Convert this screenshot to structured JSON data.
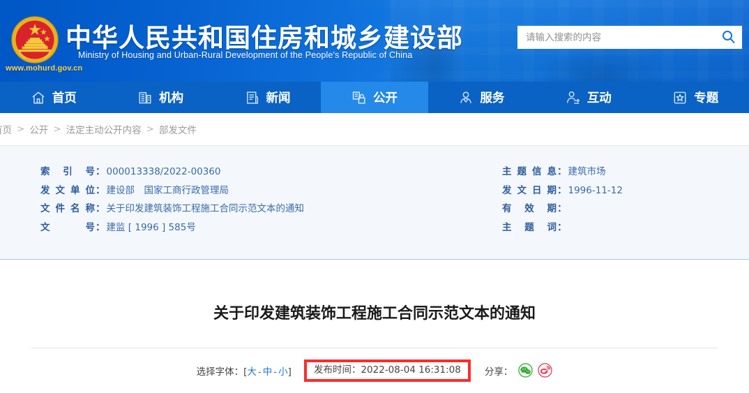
{
  "header": {
    "emblem_alt": "national-emblem",
    "title_cn": "中华人民共和国住房和城乡建设部",
    "title_en": "Ministry of Housing and Urban-Rural Development of the People's Republic of China",
    "site_url": "www.mohurd.gov.cn",
    "brand_gold": "#ffd24d",
    "banner_blue": "#0a6ad8"
  },
  "search": {
    "placeholder": "请输入搜索的内容",
    "value": "",
    "icon": "search-icon",
    "icon_color": "#1176d6"
  },
  "nav": {
    "active_index": 3,
    "active_bg": "#2489e8",
    "bar_bg": "#0a62c4",
    "items": [
      {
        "label": "首页",
        "icon": "home-icon"
      },
      {
        "label": "机构",
        "icon": "building-icon"
      },
      {
        "label": "新闻",
        "icon": "news-document-icon"
      },
      {
        "label": "公开",
        "icon": "open-info-icon"
      },
      {
        "label": "服务",
        "icon": "service-person-icon"
      },
      {
        "label": "互动",
        "icon": "interaction-person-icon"
      },
      {
        "label": "专题",
        "icon": "star-topic-icon"
      }
    ]
  },
  "breadcrumb": {
    "separator": ">",
    "items": [
      "首页",
      "公开",
      "法定主动公开内容",
      "部发文件"
    ]
  },
  "meta": {
    "left": [
      {
        "label": "索引号",
        "label_chars": [
          "索",
          "引",
          "号"
        ],
        "value": "000013338/2022-00360"
      },
      {
        "label": "发文单位",
        "label_chars": [
          "发",
          "文",
          "单",
          "位"
        ],
        "value": "建设部　国家工商行政管理局"
      },
      {
        "label": "文件名称",
        "label_chars": [
          "文",
          "件",
          "名",
          "称"
        ],
        "value": "关于印发建筑装饰工程施工合同示范文本的通知"
      },
      {
        "label": "文号",
        "label_chars": [
          "文",
          "号"
        ],
        "value": "建监 [ 1996 ] 585号"
      }
    ],
    "right": [
      {
        "label": "主题信息",
        "label_chars": [
          "主",
          "题",
          "信",
          "息"
        ],
        "value": "建筑市场"
      },
      {
        "label": "发文日期",
        "label_chars": [
          "发",
          "文",
          "日",
          "期"
        ],
        "value": "1996-11-12"
      },
      {
        "label": "有效期",
        "label_chars": [
          "有",
          "效",
          "期"
        ],
        "value": ""
      },
      {
        "label": "主题词",
        "label_chars": [
          "主",
          "题",
          "词"
        ],
        "value": ""
      }
    ],
    "colon": "：",
    "bg": "#f4f8fc",
    "text_color": "#2f5e9e"
  },
  "article": {
    "title": "关于印发建筑装饰工程施工合同示范文本的通知"
  },
  "toolbar": {
    "font_label": "选择字体：",
    "bracket_open": "[",
    "bracket_close": "]",
    "dash": "-",
    "font_sizes": [
      {
        "label": "大",
        "selected": true
      },
      {
        "label": "中",
        "selected": false
      },
      {
        "label": "小",
        "selected": false
      }
    ],
    "publish_label": "发布时间：",
    "publish_time": "2022-08-04 16:31:08",
    "highlight_color": "#fa2d2d",
    "share_label": "分享：",
    "share_items": [
      {
        "name": "wechat-share-icon",
        "color": "#3aaf3a"
      },
      {
        "name": "weibo-share-icon",
        "color": "#e2445c"
      }
    ]
  }
}
